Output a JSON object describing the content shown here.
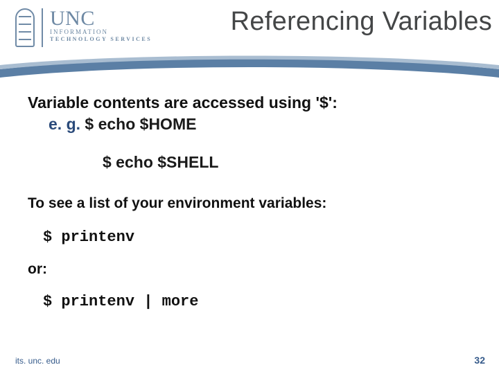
{
  "logo": {
    "unc": "UNC",
    "sub1": "INFORMATION",
    "sub2": "TECHNOLOGY SERVICES"
  },
  "title": "Referencing Variables",
  "body": {
    "intro": "Variable contents are accessed using '$':",
    "eg_label": "e. g.",
    "example1": "$ echo $HOME",
    "example2": "$ echo $SHELL",
    "envlist": "To see a list of your environment variables:",
    "cmd1": "$ printenv",
    "or": "or:",
    "cmd2": "$ printenv | more"
  },
  "footer": {
    "url": "its. unc. edu",
    "pagenum": "32"
  }
}
